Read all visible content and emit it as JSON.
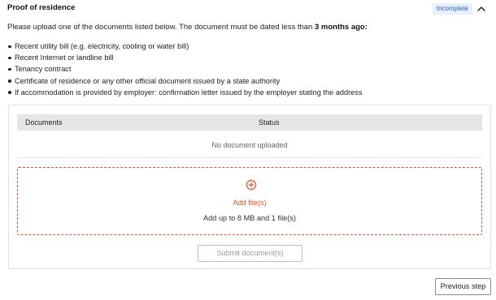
{
  "section": {
    "title": "Proof of residence",
    "status_badge": "Incomplete",
    "toggle_icon": "chevron-up-icon"
  },
  "instructions": {
    "text_before": "Please upload one of the documents listed below. The document must be dated less than ",
    "text_bold": "3 months ago:"
  },
  "document_types": [
    "Recent utility bill (e.g. electricity, cooling or water bill)",
    "Recent Internet or landline bill",
    "Tenancy contract",
    "Certificate of residence or any other official document issued by a state authority",
    "If accommodation is provided by employer: confirmation letter issued by the employer stating the address"
  ],
  "documents_table": {
    "columns": [
      "Documents",
      "Status"
    ],
    "empty_message": "No document uploaded"
  },
  "upload": {
    "icon": "add-circle-icon",
    "add_label": "Add file(s)",
    "hint": "Add up to 8 MB and 1 file(s)"
  },
  "buttons": {
    "submit": "Submit document(s)",
    "previous": "Previous step"
  },
  "colors": {
    "accent": "#e0542b",
    "badge_bg": "#e8f0fe",
    "badge_text": "#2a5db0"
  }
}
